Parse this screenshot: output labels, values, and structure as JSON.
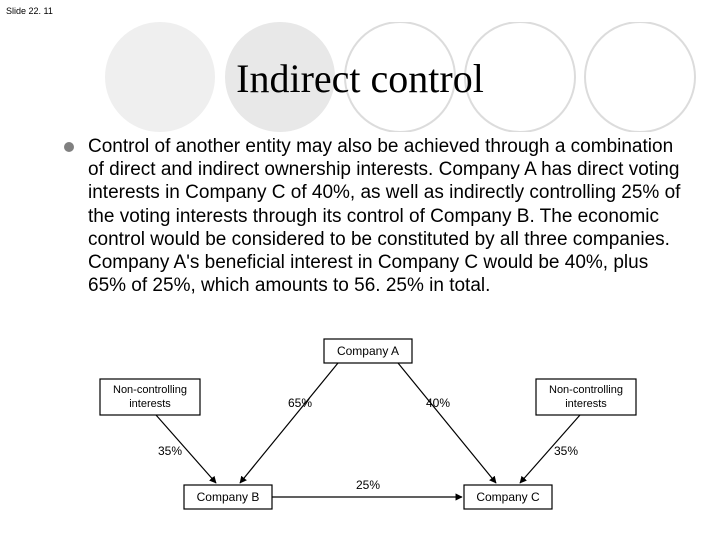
{
  "slide_number": "Slide 22. 11",
  "title": "Indirect control",
  "bullet_text": "Control of another entity may also be achieved through a combination of direct and indirect ownership interests. Company A has direct voting interests in Company C of 40%, as well as indirectly controlling 25% of the voting interests through its control of Company B. The economic control would be considered to be constituted by all three companies. Company A's beneficial interest in Company C would be 40%, plus 65% of 25%, which amounts to 56. 25% in total.",
  "diagram": {
    "nodes": {
      "company_a": "Company A",
      "company_b": "Company B",
      "company_c": "Company C",
      "nci_left": "Non-controlling interests",
      "nci_right": "Non-controlling interests"
    },
    "edges": {
      "a_to_b": "65%",
      "a_to_c": "40%",
      "nci_left_to_b": "35%",
      "nci_right_to_c": "35%",
      "b_to_c": "25%"
    }
  }
}
